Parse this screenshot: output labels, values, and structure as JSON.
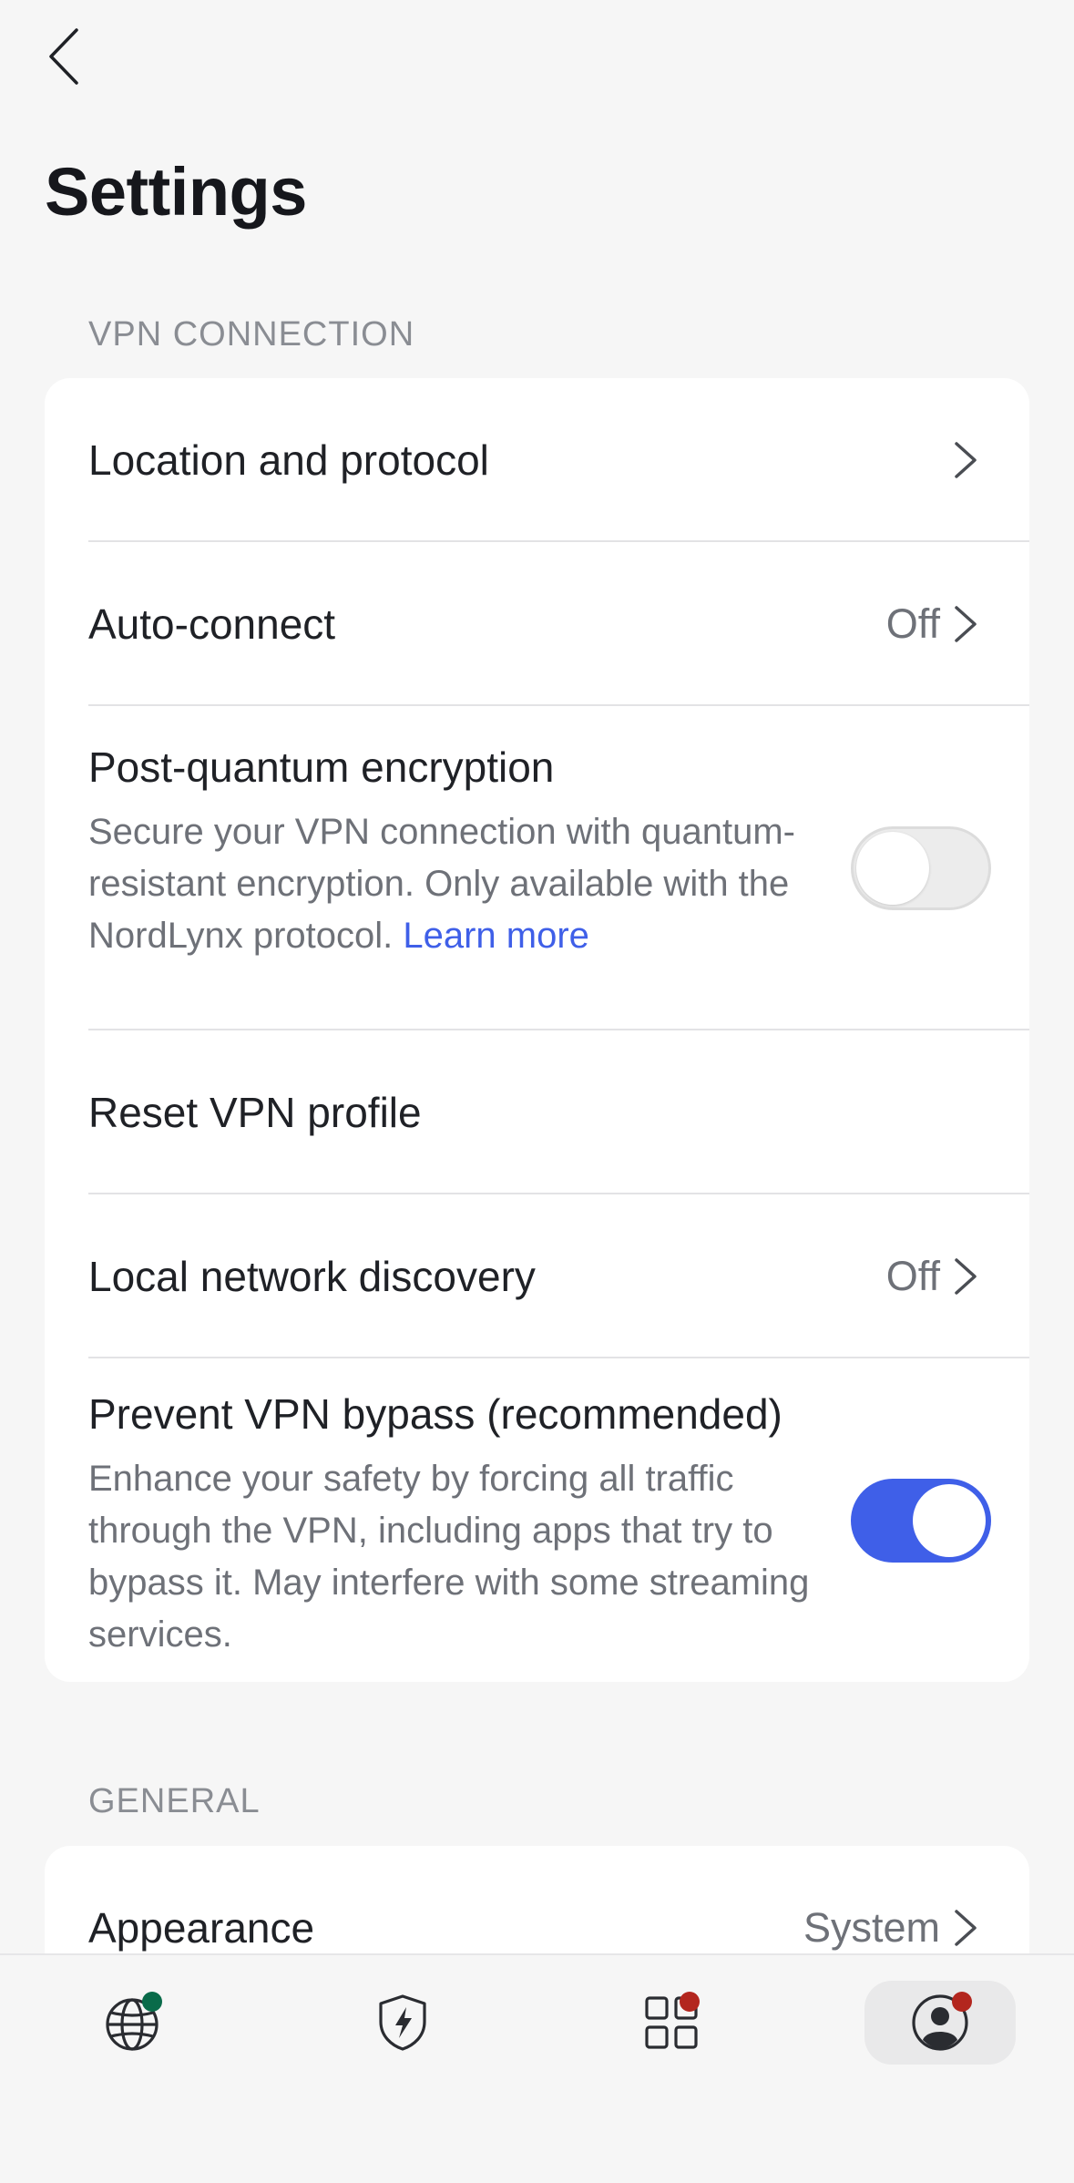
{
  "page": {
    "title": "Settings"
  },
  "sections": {
    "vpn_connection": {
      "header": "VPN CONNECTION",
      "location_protocol": {
        "label": "Location and protocol"
      },
      "auto_connect": {
        "label": "Auto-connect",
        "value": "Off"
      },
      "post_quantum": {
        "title": "Post-quantum encryption",
        "description": "Secure your VPN connection with quantum-resistant encryption. Only available with the NordLynx protocol.",
        "link": "Learn more",
        "enabled": false
      },
      "reset_profile": {
        "label": "Reset VPN profile"
      },
      "local_network": {
        "label": "Local network discovery",
        "value": "Off"
      },
      "prevent_bypass": {
        "title": "Prevent VPN bypass (recommended)",
        "description": "Enhance your safety by forcing all traffic through the VPN, including apps that try to bypass it. May interfere with some streaming services.",
        "enabled": true
      }
    },
    "general": {
      "header": "GENERAL",
      "appearance": {
        "label": "Appearance",
        "value": "System"
      }
    }
  },
  "bottom_nav": {
    "items": [
      {
        "icon": "globe-icon",
        "badge_color": "#0a6b4a"
      },
      {
        "icon": "shield-bolt-icon"
      },
      {
        "icon": "grid-apps-icon",
        "badge_color": "#b3261e"
      },
      {
        "icon": "profile-icon",
        "badge_color": "#b3261e",
        "active": true
      }
    ]
  },
  "colors": {
    "accent": "#3f5fe8",
    "background": "#f6f6f6",
    "card": "#ffffff",
    "secondary_text": "#6e7178"
  }
}
